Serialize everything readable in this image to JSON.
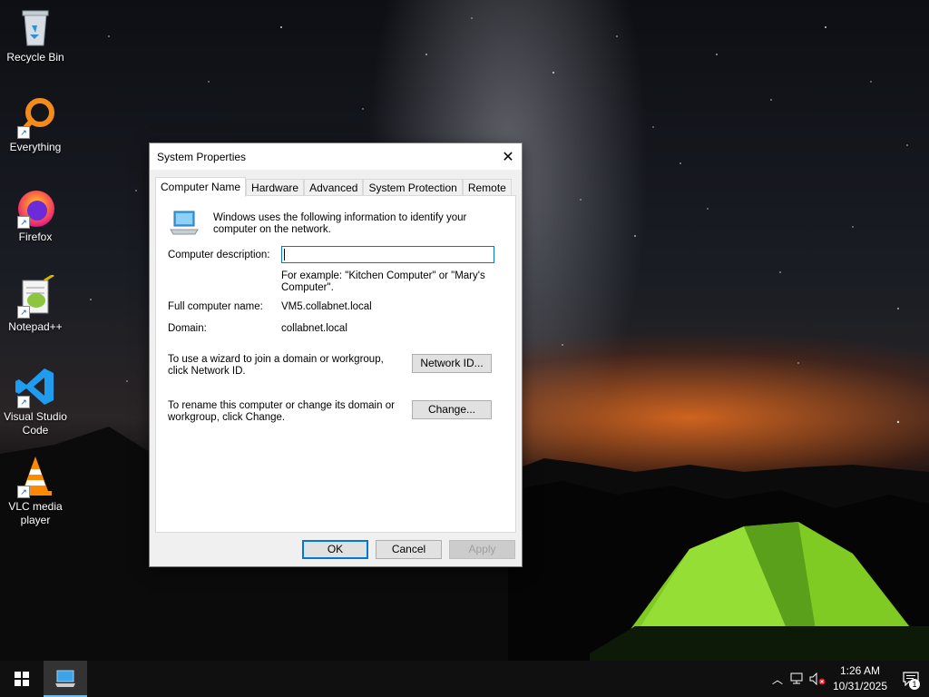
{
  "desktop": {
    "icons": [
      {
        "label": "Recycle Bin",
        "icon": "recycle-bin-icon"
      },
      {
        "label": "Everything",
        "icon": "everything-search-icon"
      },
      {
        "label": "Firefox",
        "icon": "firefox-icon"
      },
      {
        "label": "Notepad++",
        "icon": "notepad-plus-plus-icon"
      },
      {
        "label": "Visual Studio Code",
        "icon": "vscode-icon"
      },
      {
        "label": "VLC media player",
        "icon": "vlc-icon"
      }
    ]
  },
  "dialog": {
    "title": "System Properties",
    "close_glyph": "✕",
    "tabs": [
      {
        "label": "Computer Name",
        "active": true
      },
      {
        "label": "Hardware",
        "active": false
      },
      {
        "label": "Advanced",
        "active": false
      },
      {
        "label": "System Protection",
        "active": false
      },
      {
        "label": "Remote",
        "active": false
      }
    ],
    "info_text": "Windows uses the following information to identify your computer on the network.",
    "description_label": "Computer description:",
    "description_value": "",
    "example_text": "For example: \"Kitchen Computer\" or \"Mary's Computer\".",
    "full_name_label": "Full computer name:",
    "full_name_value": "VM5.collabnet.local",
    "domain_label": "Domain:",
    "domain_value": "collabnet.local",
    "wizard_text": "To use a wizard to join a domain or workgroup, click Network ID.",
    "network_id_button": "Network ID...",
    "rename_text": "To rename this computer or change its domain or workgroup, click Change.",
    "change_button": "Change...",
    "ok_button": "OK",
    "cancel_button": "Cancel",
    "apply_button": "Apply"
  },
  "taskbar": {
    "time": "1:26 AM",
    "date": "10/31/2025",
    "notification_count": "1",
    "accent": "#76b9ed"
  }
}
